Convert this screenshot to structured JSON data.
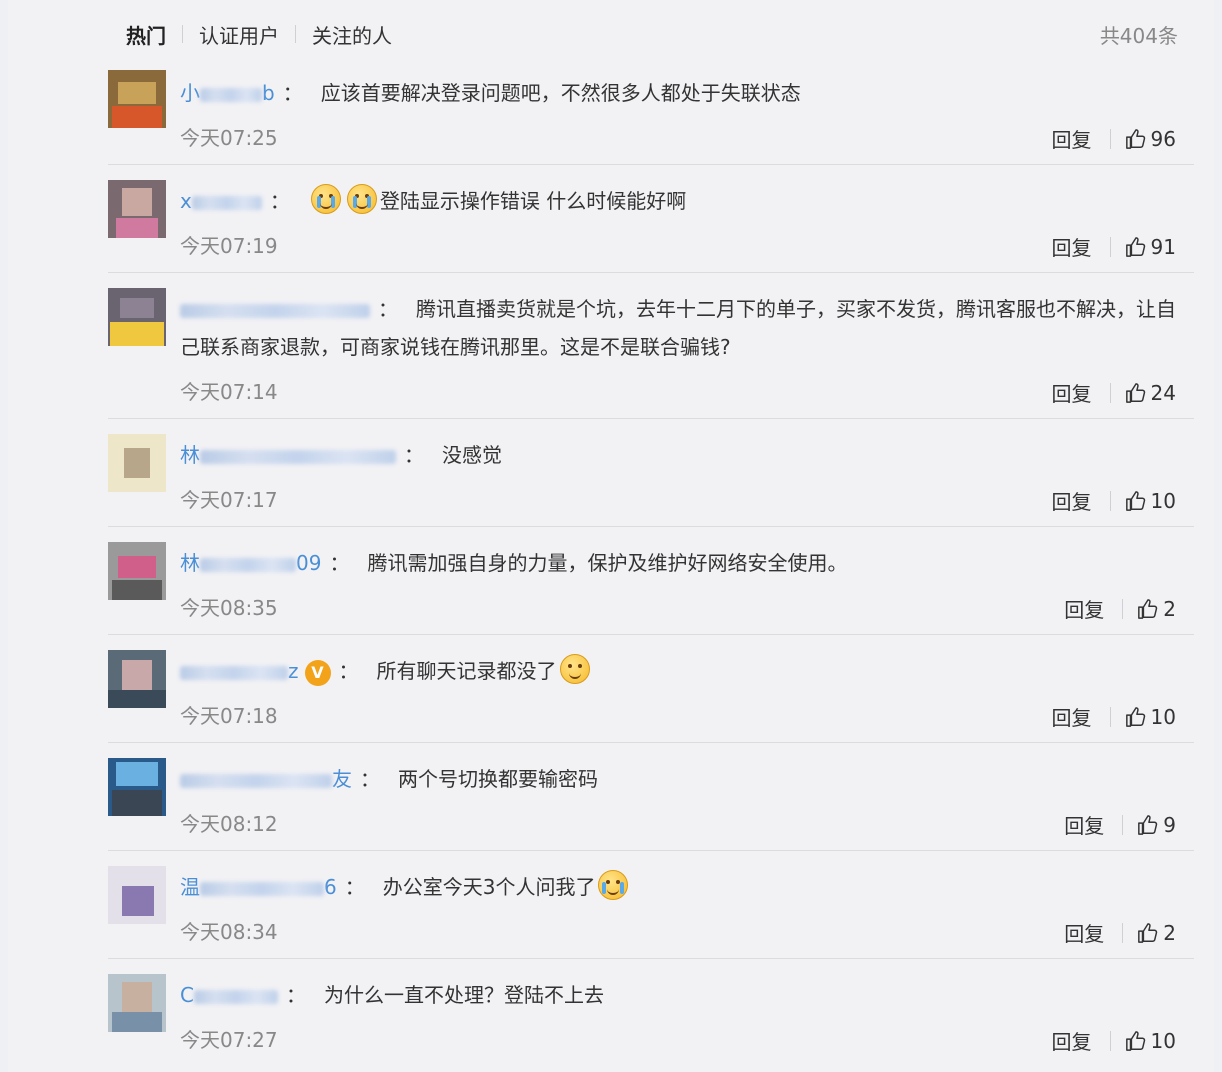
{
  "tabs": [
    {
      "label": "热门",
      "active": true
    },
    {
      "label": "认证用户",
      "active": false
    },
    {
      "label": "关注的人",
      "active": false
    }
  ],
  "total_label": "共404条",
  "reply_label": "回复",
  "comments": [
    {
      "user_start": "小",
      "user_end": "b",
      "text": "应该首要解决登录问题吧，不然很多人都处于失联状态",
      "time": "今天07:25",
      "likes": "96"
    },
    {
      "user_start": "x",
      "user_end": "",
      "text": "登陆显示操作错误 什么时候能好啊",
      "time": "今天07:19",
      "likes": "91"
    },
    {
      "user_start": "",
      "user_end": "",
      "text": "腾讯直播卖货就是个坑，去年十二月下的单子，买家不发货，腾讯客服也不解决，让自己联系商家退款，可商家说钱在腾讯那里。这是不是联合骗钱?",
      "time": "今天07:14",
      "likes": "24"
    },
    {
      "user_start": "林",
      "user_end": "",
      "text": "没感觉",
      "time": "今天07:17",
      "likes": "10"
    },
    {
      "user_start": "林",
      "user_end": "09",
      "text": "腾讯需加强自身的力量，保护及维护好网络安全使用。",
      "time": "今天08:35",
      "likes": "2"
    },
    {
      "user_start": "",
      "user_end": "z",
      "text": "所有聊天记录都没了",
      "time": "今天07:18",
      "likes": "10"
    },
    {
      "user_start": "",
      "user_end": "友",
      "text": "两个号切换都要输密码",
      "time": "今天08:12",
      "likes": "9"
    },
    {
      "user_start": "温",
      "user_end": "6",
      "text": "办公室今天3个人问我了",
      "time": "今天08:34",
      "likes": "2"
    },
    {
      "user_start": "C",
      "user_end": "",
      "text": "为什么一直不处理？登陆不上去",
      "time": "今天07:27",
      "likes": "10"
    }
  ],
  "icons": {
    "like": "thumbs-up-icon",
    "verified": "verified-v-badge-icon",
    "cry": "crying-emoji-icon",
    "smile": "smile-emoji-icon",
    "laugh_cry": "laugh-cry-emoji-icon"
  },
  "colors": {
    "username": "#4a8fd6",
    "background": "#f2f2f5",
    "verified_badge": "#f2a31a"
  }
}
